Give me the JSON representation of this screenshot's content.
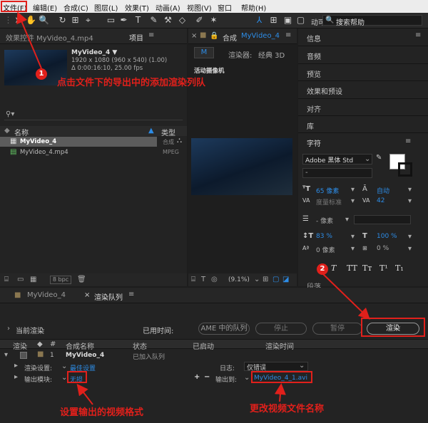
{
  "menu": [
    "文件(F)",
    "编辑(E)",
    "合成(C)",
    "图层(L)",
    "效果(T)",
    "动画(A)",
    "视图(V)",
    "窗口",
    "帮助(H)"
  ],
  "toolbar": {
    "workspace_snippet": "动可",
    "search_label": "搜索帮助"
  },
  "project_panel": {
    "effects_tab": "效果控件 MyVideo_4.mp4",
    "project_tab": "项目",
    "preview_name": "MyVideo_4 ▼",
    "preview_info1": "1920 x 1080 (960 x 540) (1.00)",
    "preview_info2": "Δ 0:00:16:10, 25.00 fps",
    "col_name": "名称",
    "col_type": "类型",
    "items": [
      {
        "name": "MyVideo_4",
        "type": "合成"
      },
      {
        "name": "MyVideo_4.mp4",
        "type": "MPEG"
      }
    ],
    "bpc": "8 bpc"
  },
  "comp_panel": {
    "tab": "合成",
    "comp_name": "MyVideo_4",
    "sub_tab": "M",
    "renderer_label": "渲染器:",
    "renderer_value": "经典 3D",
    "camera_label": "活动摄像机",
    "zoom": "(9.1%)"
  },
  "right_panel": {
    "items": [
      "信息",
      "音频",
      "预览",
      "效果和预设",
      "对齐",
      "库",
      "字符"
    ],
    "font": "Adobe 黑体 Std",
    "font_size": "65 像素",
    "leading_auto": "自动",
    "kerning": "度量标准",
    "tracking": "42",
    "stroke": "- 像素",
    "vscale": "83 %",
    "hscale": "100 %",
    "baseline": "0 像素",
    "tsume": "0 %",
    "bottom_item": "段落"
  },
  "bottom_panel": {
    "tab1": "MyVideo_4",
    "tab2": "渲染队列",
    "current_render": "当前渲染",
    "elapsed": "已用时间:",
    "ame_btn": "AME 中的队列",
    "stop_btn": "停止",
    "pause_btn": "暂停",
    "render_btn": "渲染",
    "headers": [
      "渲染",
      "#",
      "合成名称",
      "状态",
      "已启动",
      "渲染时间"
    ],
    "row": {
      "index": "1",
      "comp": "MyVideo_4",
      "status": "已加入队列"
    },
    "render_settings_label": "渲染设置:",
    "render_settings_value": "最佳设置",
    "log_label": "日志:",
    "log_value": "仅错误",
    "output_module_label": "输出模块:",
    "output_module_value": "无损",
    "output_to_label": "输出到:",
    "output_file": "MyVideo_4_1.avi"
  },
  "annotations": {
    "n1": "1",
    "n2": "2",
    "text1": "点击文件下的导出中的添加渲染列队",
    "text2": "设置输出的视频格式",
    "text3": "更改视频文件名称"
  },
  "accent_color": "#2d8ce6",
  "annotation_color": "#e1201b"
}
